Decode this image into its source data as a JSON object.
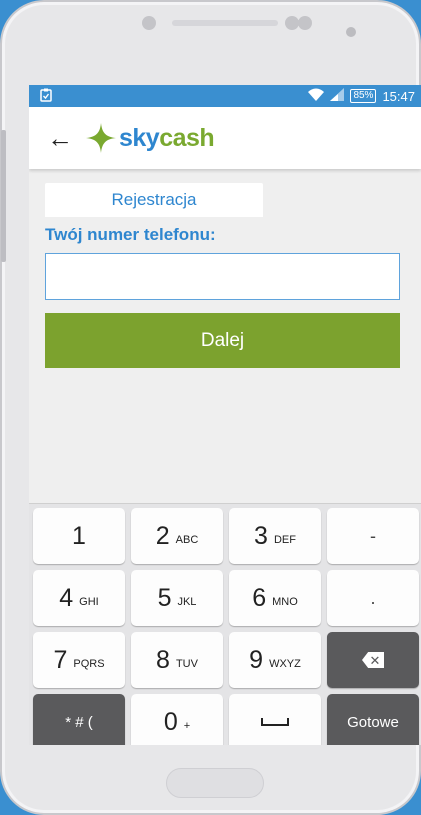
{
  "status_bar": {
    "battery": "85%",
    "time": "15:47"
  },
  "app_bar": {
    "logo_sky": "sky",
    "logo_cash": "cash"
  },
  "tabs": [
    {
      "label": "Rejestracja"
    }
  ],
  "form": {
    "phone_label": "Twój numer telefonu:",
    "phone_value": "",
    "phone_placeholder": "",
    "next_label": "Dalej"
  },
  "keyboard": {
    "rows": [
      [
        {
          "num": "1",
          "sub": ""
        },
        {
          "num": "2",
          "sub": "ABC"
        },
        {
          "num": "3",
          "sub": "DEF"
        },
        {
          "sym": "-"
        }
      ],
      [
        {
          "num": "4",
          "sub": "GHI"
        },
        {
          "num": "5",
          "sub": "JKL"
        },
        {
          "num": "6",
          "sub": "MNO"
        },
        {
          "sym": "."
        }
      ],
      [
        {
          "num": "7",
          "sub": "PQRS"
        },
        {
          "num": "8",
          "sub": "TUV"
        },
        {
          "num": "9",
          "sub": "WXYZ"
        }
      ],
      [
        {
          "sym": "* # ("
        },
        {
          "num": "0",
          "sub": "+"
        }
      ]
    ],
    "done_label": "Gotowe"
  },
  "colors": {
    "accent_blue": "#2e86cf",
    "accent_green": "#7ca22e",
    "status_bar": "#3a8fd0"
  }
}
